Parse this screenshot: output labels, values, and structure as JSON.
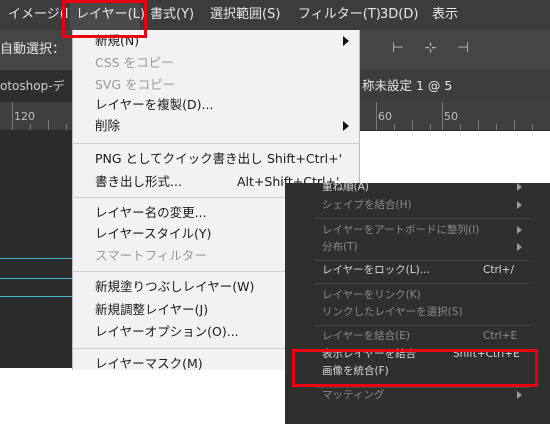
{
  "menubar": {
    "items": [
      "イメージ(I)",
      "レイヤー(L)",
      "書式(Y)",
      "選択範囲(S)",
      "フィルター(T)",
      "3D(D)",
      "表示"
    ]
  },
  "options_bar": {
    "label": "自動選択："
  },
  "tabs": {
    "left": "otoshop-デ",
    "right": "称未設定 1 @ 5"
  },
  "ruler": {
    "labels": [
      "120",
      "60",
      "50"
    ]
  },
  "menu1": {
    "items": [
      {
        "label": "新規(N)",
        "shortcut": "",
        "submenu": true,
        "disabled": false
      },
      {
        "label": "CSS をコピー",
        "shortcut": "",
        "submenu": false,
        "disabled": true
      },
      {
        "label": "SVG をコピー",
        "shortcut": "",
        "submenu": false,
        "disabled": true
      },
      {
        "label": "レイヤーを複製(D)...",
        "shortcut": "",
        "submenu": false,
        "disabled": false
      },
      {
        "label": "削除",
        "shortcut": "",
        "submenu": true,
        "disabled": false
      },
      {
        "label": "PNG としてクイック書き出し",
        "shortcut": "Shift+Ctrl+'",
        "submenu": false,
        "disabled": false
      },
      {
        "label": "書き出し形式...",
        "shortcut": "Alt+Shift+Ctrl+'",
        "submenu": false,
        "disabled": false
      },
      {
        "label": "レイヤー名の変更...",
        "shortcut": "",
        "submenu": false,
        "disabled": false
      },
      {
        "label": "レイヤースタイル(Y)",
        "shortcut": "",
        "submenu": true,
        "disabled": false
      },
      {
        "label": "スマートフィルター",
        "shortcut": "",
        "submenu": false,
        "disabled": true
      },
      {
        "label": "新規塗りつぶしレイヤー(W)",
        "shortcut": "",
        "submenu": true,
        "disabled": false
      },
      {
        "label": "新規調整レイヤー(J)",
        "shortcut": "",
        "submenu": true,
        "disabled": false
      },
      {
        "label": "レイヤーオプション(O)...",
        "shortcut": "",
        "submenu": false,
        "disabled": false
      },
      {
        "label": "レイヤーマスク(M)",
        "shortcut": "",
        "submenu": true,
        "disabled": false
      }
    ]
  },
  "menu2": {
    "items": [
      {
        "label": "重ね順(A)",
        "shortcut": "",
        "submenu": true,
        "disabled": false
      },
      {
        "label": "シェイプを結合(H)",
        "shortcut": "",
        "submenu": true,
        "disabled": true
      },
      {
        "label": "レイヤーをアートボードに整列(I)",
        "shortcut": "",
        "submenu": true,
        "disabled": true
      },
      {
        "label": "分布(T)",
        "shortcut": "",
        "submenu": true,
        "disabled": true
      },
      {
        "label": "レイヤーをロック(L)...",
        "shortcut": "Ctrl+/",
        "submenu": false,
        "disabled": false
      },
      {
        "label": "レイヤーをリンク(K)",
        "shortcut": "",
        "submenu": false,
        "disabled": true
      },
      {
        "label": "リンクしたレイヤーを選択(S)",
        "shortcut": "",
        "submenu": false,
        "disabled": true
      },
      {
        "label": "レイヤーを結合(E)",
        "shortcut": "Ctrl+E",
        "submenu": false,
        "disabled": true
      },
      {
        "label": "表示レイヤーを結合",
        "shortcut": "Shift+Ctrl+E",
        "submenu": false,
        "disabled": false
      },
      {
        "label": "画像を統合(F)",
        "shortcut": "",
        "submenu": false,
        "disabled": false
      },
      {
        "label": "マッティング",
        "shortcut": "",
        "submenu": true,
        "disabled": true
      }
    ]
  },
  "colors": {
    "highlight": "#e60012",
    "guide": "#35b9c7"
  }
}
